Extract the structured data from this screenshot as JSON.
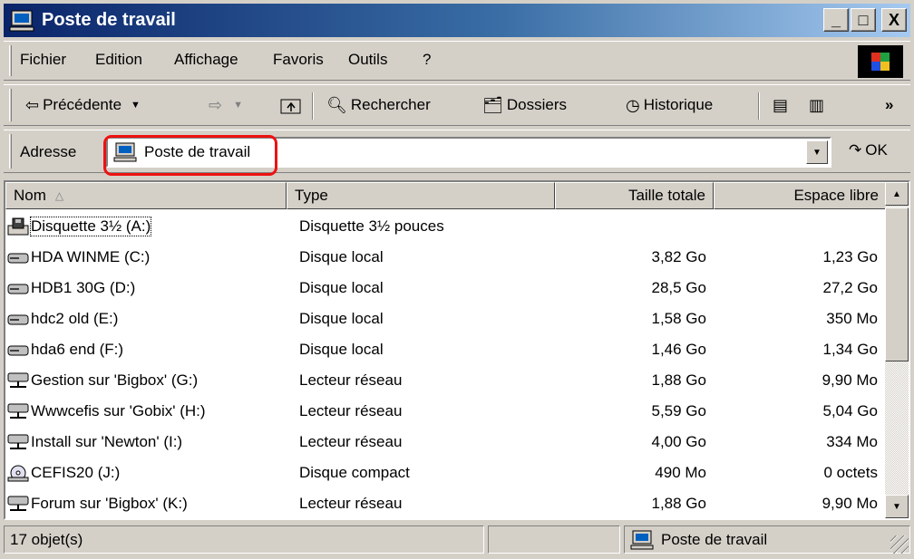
{
  "window": {
    "title": "Poste de travail",
    "controls": {
      "minimize": "_",
      "maximize": "□",
      "close": "X"
    }
  },
  "menu": {
    "items": [
      "Fichier",
      "Edition",
      "Affichage",
      "Favoris",
      "Outils",
      "?"
    ]
  },
  "toolbar": {
    "back_label": "Précédente",
    "search_label": "Rechercher",
    "folders_label": "Dossiers",
    "history_label": "Historique",
    "more_label": "»"
  },
  "address": {
    "label": "Adresse",
    "value": "Poste de travail",
    "go_label": "OK"
  },
  "columns": {
    "name": "Nom",
    "type": "Type",
    "total": "Taille totale",
    "free": "Espace libre"
  },
  "rows": [
    {
      "name": "Disquette 3½ (A:)",
      "type": "Disquette 3½ pouces",
      "total": "",
      "free": "",
      "icon": "floppy-drive-icon"
    },
    {
      "name": "HDA WINME (C:)",
      "type": "Disque local",
      "total": "3,82 Go",
      "free": "1,23 Go",
      "icon": "hard-disk-icon"
    },
    {
      "name": "HDB1 30G (D:)",
      "type": "Disque local",
      "total": "28,5 Go",
      "free": "27,2 Go",
      "icon": "hard-disk-icon"
    },
    {
      "name": "hdc2 old (E:)",
      "type": "Disque local",
      "total": "1,58 Go",
      "free": "350 Mo",
      "icon": "hard-disk-icon"
    },
    {
      "name": "hda6 end (F:)",
      "type": "Disque local",
      "total": "1,46 Go",
      "free": "1,34 Go",
      "icon": "hard-disk-icon"
    },
    {
      "name": "Gestion sur 'Bigbox' (G:)",
      "type": "Lecteur réseau",
      "total": "1,88 Go",
      "free": "9,90 Mo",
      "icon": "network-drive-icon"
    },
    {
      "name": "Wwwcefis sur 'Gobix' (H:)",
      "type": "Lecteur réseau",
      "total": "5,59 Go",
      "free": "5,04 Go",
      "icon": "network-drive-icon"
    },
    {
      "name": "Install sur 'Newton' (I:)",
      "type": "Lecteur réseau",
      "total": "4,00 Go",
      "free": "334 Mo",
      "icon": "network-drive-icon"
    },
    {
      "name": "CEFIS20 (J:)",
      "type": "Disque compact",
      "total": "490 Mo",
      "free": "0 octets",
      "icon": "cd-drive-icon"
    },
    {
      "name": "Forum sur 'Bigbox' (K:)",
      "type": "Lecteur réseau",
      "total": "1,88 Go",
      "free": "9,90 Mo",
      "icon": "network-drive-icon"
    }
  ],
  "status": {
    "count": "17 objet(s)",
    "location": "Poste de travail"
  },
  "colors": {
    "title_start": "#0a246a",
    "title_end": "#a6caf0",
    "face": "#d4d0c8",
    "highlight_outline": "#ee1111"
  }
}
